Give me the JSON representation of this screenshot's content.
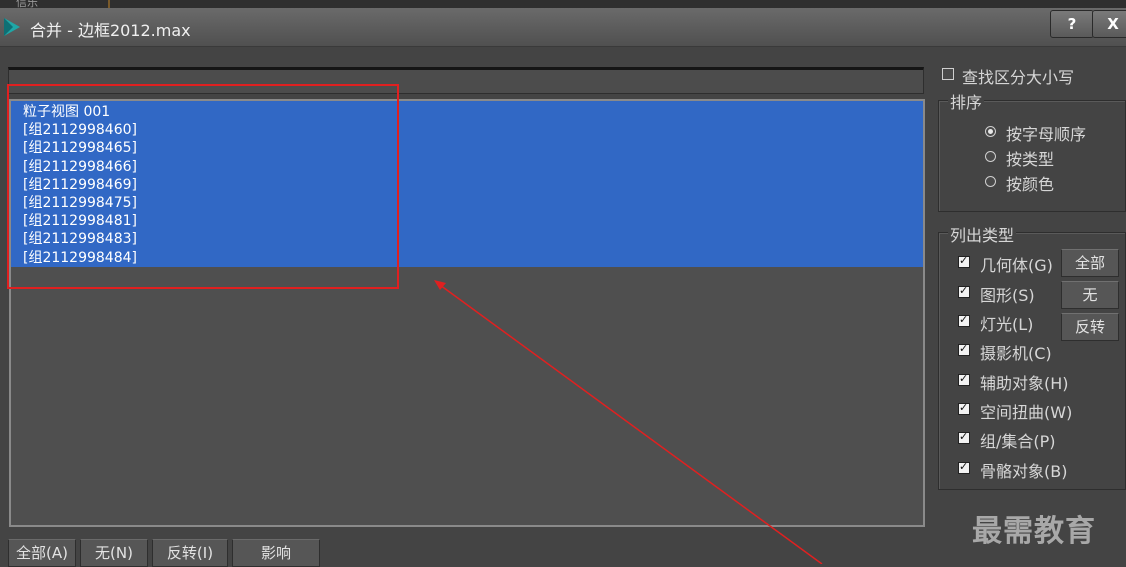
{
  "window": {
    "title": "合并 - 边框2012.max",
    "top_fragment": "信乐",
    "help_label": "?",
    "close_label": "X"
  },
  "search": {
    "value": ""
  },
  "object_list": {
    "items": [
      "粒子视图 001",
      "[组2112998460]",
      "[组2112998465]",
      "[组2112998466]",
      "[组2112998469]",
      "[组2112998475]",
      "[组2112998481]",
      "[组2112998483]",
      "[组2112998484]"
    ],
    "all_selected": true
  },
  "bottom_buttons": {
    "all": "全部(A)",
    "none": "无(N)",
    "invert": "反转(I)",
    "influence": "影响"
  },
  "case_sensitive": {
    "label": "查找区分大小写",
    "checked": false
  },
  "sort": {
    "title": "排序",
    "options": [
      {
        "label": "按字母顺序",
        "selected": true
      },
      {
        "label": "按类型",
        "selected": false
      },
      {
        "label": "按颜色",
        "selected": false
      }
    ]
  },
  "list_types": {
    "title": "列出类型",
    "items": [
      {
        "label": "几何体(G)",
        "checked": true
      },
      {
        "label": "图形(S)",
        "checked": true
      },
      {
        "label": "灯光(L)",
        "checked": true
      },
      {
        "label": "摄影机(C)",
        "checked": true
      },
      {
        "label": "辅助对象(H)",
        "checked": true
      },
      {
        "label": "空间扭曲(W)",
        "checked": true
      },
      {
        "label": "组/集合(P)",
        "checked": true
      },
      {
        "label": "骨骼对象(B)",
        "checked": true
      }
    ],
    "buttons": {
      "all": "全部",
      "none": "无",
      "invert": "反转"
    }
  },
  "watermark": "最需教育",
  "colors": {
    "selection": "#3168c5",
    "annotation": "#e02020",
    "background": "#444444"
  }
}
